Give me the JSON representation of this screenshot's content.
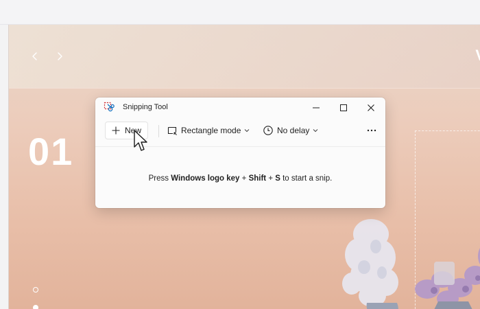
{
  "hero": {
    "brand_letter": "V",
    "number": "01",
    "prev_icon": "chevron-left-icon",
    "next_icon": "chevron-right-icon"
  },
  "snipping_tool": {
    "title": "Snipping Tool",
    "title_icon": "snipping-tool-icon",
    "window_buttons": [
      "minimize-icon",
      "maximize-icon",
      "close-icon"
    ],
    "toolbar": {
      "new_label": "New",
      "mode_label": "Rectangle mode",
      "delay_label": "No delay",
      "more_icon": "more-icon"
    },
    "hint": {
      "prefix": "Press ",
      "key1": "Windows logo key",
      "plus1": " + ",
      "key2": "Shift",
      "plus2": " + ",
      "key3": "S",
      "suffix": " to start a snip."
    }
  },
  "colors": {
    "accent": "#0f6cbd",
    "window_bg": "#fbfbfb",
    "hero_top": "#e9d7ca",
    "hero_bottom": "#e2b39b"
  }
}
